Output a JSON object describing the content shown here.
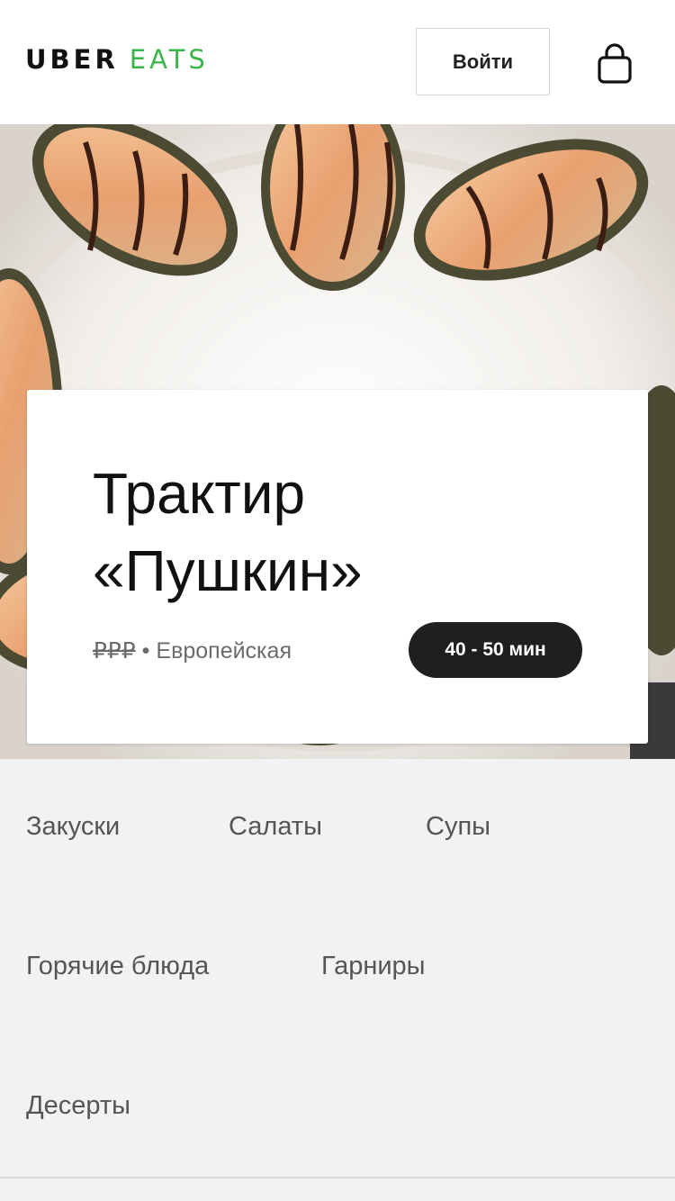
{
  "header": {
    "logo_primary": "UBER",
    "logo_secondary": "EATS",
    "signin_label": "Войти",
    "cart_icon": "shopping-bag-icon",
    "logo_colors": {
      "primary": "#111111",
      "secondary": "#3ab54a"
    }
  },
  "restaurant": {
    "name_line1": "Трактир",
    "name_line2": "«Пушкин»",
    "price_level": "₽₽₽",
    "separator": "•",
    "cuisine": "Европейская",
    "delivery_time": "40 - 50 мин"
  },
  "categories": [
    {
      "label": "Закуски"
    },
    {
      "label": "Салаты"
    },
    {
      "label": "Супы"
    },
    {
      "label": "Горячие блюда"
    },
    {
      "label": "Гарниры"
    },
    {
      "label": "Десерты"
    }
  ]
}
